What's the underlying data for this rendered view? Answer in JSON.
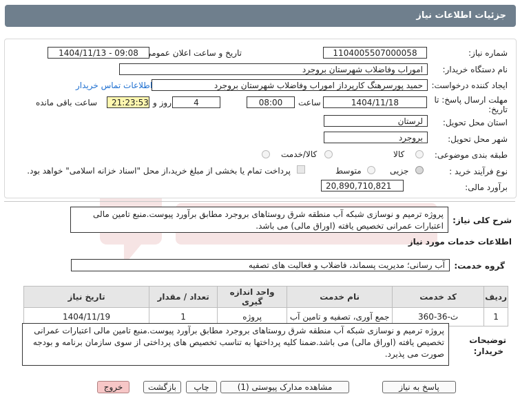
{
  "header": {
    "title": "جزئیات اطلاعات نیاز"
  },
  "form": {
    "need_number_label": "شماره نیاز:",
    "need_number": "1104005507000058",
    "announce_label": "تاریخ و ساعت اعلان عمومی:",
    "announce_value": "1404/11/13 - 09:08",
    "buyer_label": "نام دستگاه خریدار:",
    "buyer_value": "اموراب وفاضلاب شهرستان بروجرد",
    "creator_label": "ایجاد کننده درخواست:",
    "creator_value": "حمید پورسرهنگ کارپرداز اموراب وفاضلاب شهرستان بروجرد",
    "contact_link": "اطلاعات تماس خریدار",
    "deadline_label_1": "مهلت ارسال پاسخ: تا",
    "deadline_label_2": "تاریخ:",
    "deadline_date": "1404/11/18",
    "time_label": "ساعت",
    "deadline_time": "08:00",
    "days_value": "4",
    "days_label": "روز و",
    "remaining_time": "21:23:53",
    "remaining_label": "ساعت باقی مانده",
    "province_label": "استان محل تحویل:",
    "province_value": "لرستان",
    "city_label": "شهر محل تحویل:",
    "city_value": "بروجرد",
    "category_label": "طبقه بندی موضوعی:",
    "category_options": [
      "کالا",
      "کالا/خدمت",
      "خدمت"
    ],
    "process_label": "نوع فرآیند خرید :",
    "process_options": [
      "جزیی",
      "متوسط"
    ],
    "treasury_note": "پرداخت تمام یا بخشی از مبلغ خرید،از محل \"اسناد خزانه اسلامی\" خواهد بود.",
    "budget_label": "برآورد مالی:",
    "budget_value": "20,890,710,821"
  },
  "summary": {
    "label": "شرح کلی نیاز:",
    "text": "پروژه ترمیم و نوسازی شبکه آب منطقه شرق روستاهای بروجرد مطابق برآورد پیوست.منبع تامین مالی اعتبارات عمرانی تخصیص یافته (اوراق مالی) می باشد."
  },
  "services": {
    "section_title": "اطلاعات خدمات مورد نیاز",
    "group_label": "گروه خدمت:",
    "group_value": "آب رسانی؛ مدیریت پسماند، فاضلاب و فعالیت های تصفیه",
    "columns": [
      "ردیف",
      "کد خدمت",
      "نام خدمت",
      "واحد اندازه گیری",
      "تعداد / مقدار",
      "تاریخ نیاز"
    ],
    "rows": [
      {
        "row": "1",
        "code": "ث-36-360",
        "name": "جمع آوری، تصفیه و تامین آب",
        "unit": "پروژه",
        "qty": "1",
        "date": "1404/11/19"
      }
    ]
  },
  "buyer_notes": {
    "label_1": "توضیحات",
    "label_2": "خریدار:",
    "text": "پروژه ترمیم و نوسازی شبکه آب منطقه شرق روستاهای بروجرد مطابق برآورد پیوست.منبع تامین مالی اعتبارات عمرانی تخصیص یافته (اوراق مالی) می باشد.ضمنا کلیه پرداختها به تناسب تخصیص های پرداختی از سوی سازمان برنامه و بودجه صورت می پذیرد."
  },
  "buttons": {
    "reply": "پاسخ به نیاز",
    "attachments": "مشاهده مدارک پیوستی (1)",
    "print": "چاپ",
    "back": "بازگشت",
    "exit": "خروج"
  },
  "colors": {
    "title_bg": "#6f7f8d",
    "time_highlight": "#fff8b0",
    "exit_bg": "#f7c7c7"
  }
}
